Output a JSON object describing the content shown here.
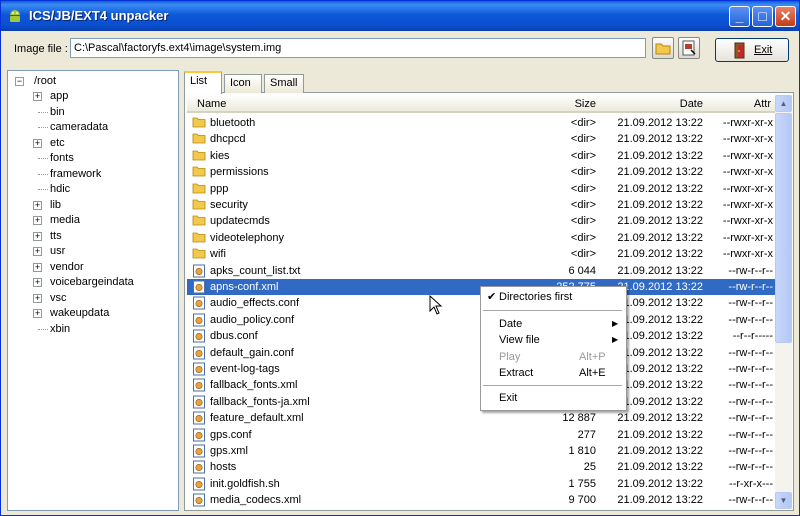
{
  "window": {
    "title": "ICS/JB/EXT4 unpacker",
    "minimize_glyph": "_",
    "maximize_glyph": "□",
    "close_glyph": "✕"
  },
  "toolbar": {
    "image_label": "Image file :",
    "image_path": "C:\\Pascal\\factoryfs.ext4\\image\\system.img",
    "exit_label": "Exit"
  },
  "tree": {
    "root": "/root",
    "items": [
      {
        "label": "app",
        "expandable": true
      },
      {
        "label": "bin",
        "expandable": false
      },
      {
        "label": "cameradata",
        "expandable": false
      },
      {
        "label": "etc",
        "expandable": true
      },
      {
        "label": "fonts",
        "expandable": false
      },
      {
        "label": "framework",
        "expandable": false
      },
      {
        "label": "hdic",
        "expandable": false
      },
      {
        "label": "lib",
        "expandable": true
      },
      {
        "label": "media",
        "expandable": true
      },
      {
        "label": "tts",
        "expandable": true
      },
      {
        "label": "usr",
        "expandable": true
      },
      {
        "label": "vendor",
        "expandable": true
      },
      {
        "label": "voicebargeindata",
        "expandable": true
      },
      {
        "label": "vsc",
        "expandable": true
      },
      {
        "label": "wakeupdata",
        "expandable": true
      },
      {
        "label": "xbin",
        "expandable": false
      }
    ]
  },
  "tabs": [
    {
      "label": "List"
    },
    {
      "label": "Icon"
    },
    {
      "label": "Small"
    }
  ],
  "list": {
    "columns": {
      "name": "Name",
      "size": "Size",
      "date": "Date",
      "attr": "Attr"
    },
    "rows": [
      {
        "type": "folder",
        "name": "bluetooth",
        "size": "<dir>",
        "date": "21.09.2012 13:22",
        "attr": "--rwxr-xr-x"
      },
      {
        "type": "folder",
        "name": "dhcpcd",
        "size": "<dir>",
        "date": "21.09.2012 13:22",
        "attr": "--rwxr-xr-x"
      },
      {
        "type": "folder",
        "name": "kies",
        "size": "<dir>",
        "date": "21.09.2012 13:22",
        "attr": "--rwxr-xr-x"
      },
      {
        "type": "folder",
        "name": "permissions",
        "size": "<dir>",
        "date": "21.09.2012 13:22",
        "attr": "--rwxr-xr-x"
      },
      {
        "type": "folder",
        "name": "ppp",
        "size": "<dir>",
        "date": "21.09.2012 13:22",
        "attr": "--rwxr-xr-x"
      },
      {
        "type": "folder",
        "name": "security",
        "size": "<dir>",
        "date": "21.09.2012 13:22",
        "attr": "--rwxr-xr-x"
      },
      {
        "type": "folder",
        "name": "updatecmds",
        "size": "<dir>",
        "date": "21.09.2012 13:22",
        "attr": "--rwxr-xr-x"
      },
      {
        "type": "folder",
        "name": "videotelephony",
        "size": "<dir>",
        "date": "21.09.2012 13:22",
        "attr": "--rwxr-xr-x"
      },
      {
        "type": "folder",
        "name": "wifi",
        "size": "<dir>",
        "date": "21.09.2012 13:22",
        "attr": "--rwxr-xr-x"
      },
      {
        "type": "file",
        "name": "apks_count_list.txt",
        "size": "6 044",
        "date": "21.09.2012 13:22",
        "attr": "--rw-r--r--"
      },
      {
        "type": "file",
        "name": "apns-conf.xml",
        "size": "252 775",
        "date": "21.09.2012 13:22",
        "attr": "--rw-r--r--",
        "selected": true
      },
      {
        "type": "file",
        "name": "audio_effects.conf",
        "size": "",
        "date": "21.09.2012 13:22",
        "attr": "--rw-r--r--"
      },
      {
        "type": "file",
        "name": "audio_policy.conf",
        "size": "",
        "date": "21.09.2012 13:22",
        "attr": "--rw-r--r--"
      },
      {
        "type": "file",
        "name": "dbus.conf",
        "size": "",
        "date": "21.09.2012 13:22",
        "attr": "--r--r-----"
      },
      {
        "type": "file",
        "name": "default_gain.conf",
        "size": "",
        "date": "21.09.2012 13:22",
        "attr": "--rw-r--r--"
      },
      {
        "type": "file",
        "name": "event-log-tags",
        "size": "",
        "date": "21.09.2012 13:22",
        "attr": "--rw-r--r--"
      },
      {
        "type": "file",
        "name": "fallback_fonts.xml",
        "size": "",
        "date": "21.09.2012 13:22",
        "attr": "--rw-r--r--"
      },
      {
        "type": "file",
        "name": "fallback_fonts-ja.xml",
        "size": "",
        "date": "21.09.2012 13:22",
        "attr": "--rw-r--r--"
      },
      {
        "type": "file",
        "name": "feature_default.xml",
        "size": "12 887",
        "date": "21.09.2012 13:22",
        "attr": "--rw-r--r--"
      },
      {
        "type": "file",
        "name": "gps.conf",
        "size": "277",
        "date": "21.09.2012 13:22",
        "attr": "--rw-r--r--"
      },
      {
        "type": "file",
        "name": "gps.xml",
        "size": "1 810",
        "date": "21.09.2012 13:22",
        "attr": "--rw-r--r--"
      },
      {
        "type": "file",
        "name": "hosts",
        "size": "25",
        "date": "21.09.2012 13:22",
        "attr": "--rw-r--r--"
      },
      {
        "type": "file",
        "name": "init.goldfish.sh",
        "size": "1 755",
        "date": "21.09.2012 13:22",
        "attr": "--r-xr-x---"
      },
      {
        "type": "file",
        "name": "media_codecs.xml",
        "size": "9 700",
        "date": "21.09.2012 13:22",
        "attr": "--rw-r--r--"
      }
    ]
  },
  "context_menu": {
    "items": [
      {
        "label": "Directories first",
        "checked": true
      },
      {
        "separator": true
      },
      {
        "label": "Date",
        "submenu": true
      },
      {
        "label": "View file",
        "submenu": true
      },
      {
        "label": "Play",
        "shortcut": "Alt+P",
        "disabled": true
      },
      {
        "label": "Extract",
        "shortcut": "Alt+E"
      },
      {
        "separator": true
      },
      {
        "label": "Exit"
      }
    ]
  },
  "colors": {
    "selection": "#316ac5",
    "title_bar": "#0a4fcf",
    "folder": "#f2c94c"
  }
}
